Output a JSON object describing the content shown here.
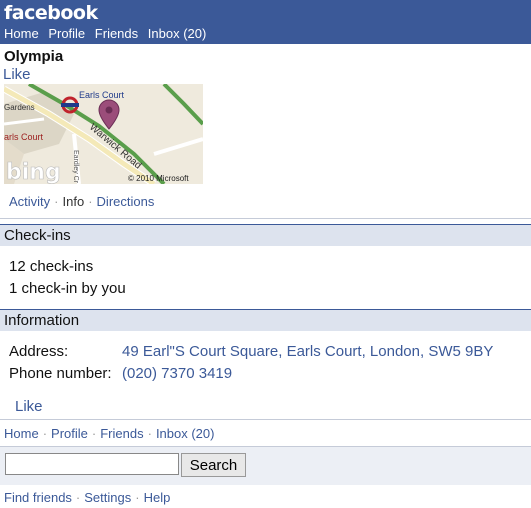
{
  "header": {
    "logo": "facebook",
    "nav": [
      "Home",
      "Profile",
      "Friends",
      "Inbox (20)"
    ]
  },
  "place": {
    "name": "Olympia",
    "like": "Like"
  },
  "map": {
    "labels": {
      "station": "Earls Court",
      "gardens": "Gardens",
      "earls_court_left": "arls Court",
      "road": "Warwick Road",
      "eardley": "Eardley Cr",
      "copyright": "© 2010 Microsoft",
      "bing": "bing"
    }
  },
  "tabs": [
    "Activity",
    "Info",
    "Directions"
  ],
  "checkins": {
    "heading": "Check-ins",
    "total": "12 check-ins",
    "mine": "1 check-in by you"
  },
  "information": {
    "heading": "Information",
    "address_label": "Address:",
    "address_value": "49 Earl\"S Court Square, Earls Court, London, SW5 9BY",
    "phone_label": "Phone number:",
    "phone_value": "(020) 7370 3419",
    "like": "Like"
  },
  "footer_nav": [
    "Home",
    "Profile",
    "Friends",
    "Inbox (20)"
  ],
  "search": {
    "value": "",
    "button_label": "Search"
  },
  "bottom_links": [
    "Find friends",
    "Settings",
    "Help"
  ],
  "colors": {
    "brand": "#3b5998",
    "section_bg": "#dde3ee"
  }
}
